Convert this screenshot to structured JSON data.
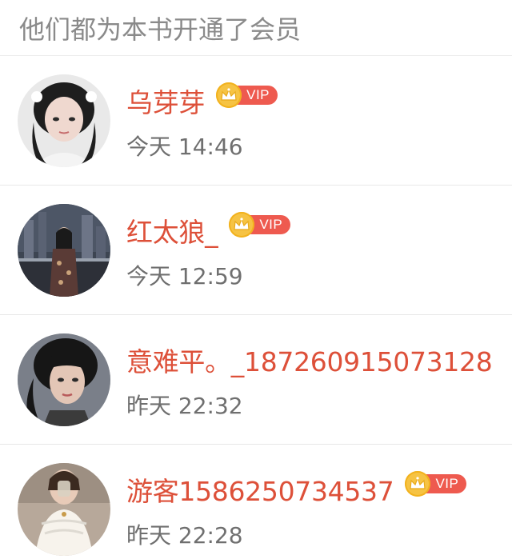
{
  "header": {
    "title": "他们都为本书开通了会员"
  },
  "members": [
    {
      "name": "乌芽芽",
      "vip_label": "VIP",
      "time": "今天 14:46",
      "is_vip": true
    },
    {
      "name": "红太狼_",
      "vip_label": "VIP",
      "time": "今天 12:59",
      "is_vip": true
    },
    {
      "name": "意难平。_187260915073128",
      "vip_label": "",
      "time": "昨天 22:32",
      "is_vip": false
    },
    {
      "name": "游客1586250734537",
      "vip_label": "VIP",
      "time": "昨天 22:28",
      "is_vip": true
    }
  ],
  "colors": {
    "username": "#dd5039",
    "vip_badge": "#ee5a4f",
    "crown": "#f6c343",
    "header_text": "#8a8a8a",
    "timestamp": "#6f6f6f"
  },
  "icons": {
    "crown": "crown-icon",
    "avatar": "user-avatar"
  }
}
